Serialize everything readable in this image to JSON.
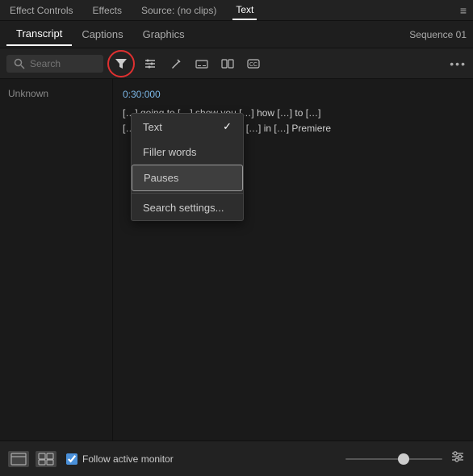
{
  "topBar": {
    "items": [
      {
        "label": "Effect Controls",
        "active": false
      },
      {
        "label": "Effects",
        "active": false
      },
      {
        "label": "Source: (no clips)",
        "active": false
      },
      {
        "label": "Text",
        "active": true
      }
    ],
    "hamburger": "≡"
  },
  "tabs": {
    "items": [
      {
        "label": "Transcript",
        "active": true
      },
      {
        "label": "Captions",
        "active": false
      },
      {
        "label": "Graphics",
        "active": false
      }
    ],
    "sequenceLabel": "Sequence 01"
  },
  "toolbar": {
    "searchPlaceholder": "Search",
    "moreLabel": "•••"
  },
  "transcript": {
    "speaker": "Unknown",
    "timestamp": "0:30:000",
    "lines": [
      "[…] going to […] show you […] how […] to […]",
      "[…] from […] your […] audio […] in […] Premiere"
    ]
  },
  "dropdown": {
    "items": [
      {
        "label": "Text",
        "checked": true,
        "highlighted": false
      },
      {
        "label": "Filler words",
        "checked": false,
        "highlighted": false
      },
      {
        "label": "Pauses",
        "checked": false,
        "highlighted": true
      },
      {
        "label": "Search settings...",
        "checked": false,
        "highlighted": false,
        "divider": true
      }
    ]
  },
  "bottomBar": {
    "followLabel": "Follow active monitor",
    "icon1": "⊡",
    "icon2": "⊞"
  },
  "colors": {
    "accent": "#e03030",
    "activeTab": "#ffffff",
    "timestamp": "#7cb8e8"
  }
}
